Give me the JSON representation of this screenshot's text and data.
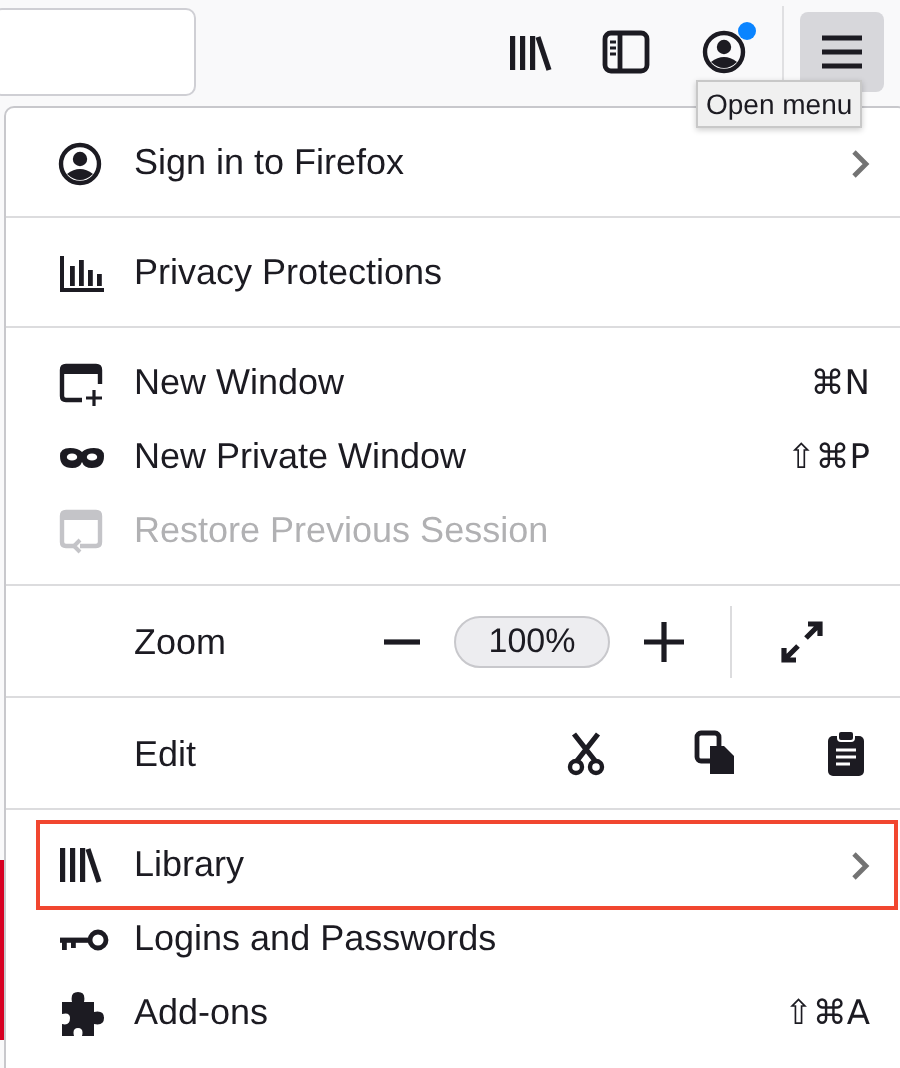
{
  "toolbar": {
    "account_notification": true,
    "menu_button_pressed": true,
    "tooltip": "Open menu"
  },
  "menu": {
    "sections": [
      {
        "items": [
          {
            "kind": "item",
            "label": "Sign in to Firefox",
            "submenu": true,
            "disabled": false,
            "highlighted": false
          }
        ]
      },
      {
        "items": [
          {
            "kind": "item",
            "label": "Privacy Protections",
            "submenu": false,
            "disabled": false,
            "highlighted": false
          }
        ]
      },
      {
        "items": [
          {
            "kind": "item",
            "label": "New Window",
            "shortcut": "⌘N",
            "submenu": false,
            "disabled": false,
            "highlighted": false
          },
          {
            "kind": "item",
            "label": "New Private Window",
            "shortcut": "⇧⌘P",
            "submenu": false,
            "disabled": false,
            "highlighted": false
          },
          {
            "kind": "item",
            "label": "Restore Previous Session",
            "submenu": false,
            "disabled": true,
            "highlighted": false
          }
        ]
      },
      {
        "items": [
          {
            "kind": "zoom",
            "label": "Zoom",
            "value": "100%"
          }
        ]
      },
      {
        "items": [
          {
            "kind": "edit",
            "label": "Edit"
          }
        ]
      },
      {
        "items": [
          {
            "kind": "item",
            "label": "Library",
            "submenu": true,
            "disabled": false,
            "highlighted": true
          },
          {
            "kind": "item",
            "label": "Logins and Passwords",
            "submenu": false,
            "disabled": false,
            "highlighted": false
          },
          {
            "kind": "item",
            "label": "Add-ons",
            "shortcut": "⇧⌘A",
            "submenu": false,
            "disabled": false,
            "highlighted": false
          }
        ]
      }
    ]
  }
}
